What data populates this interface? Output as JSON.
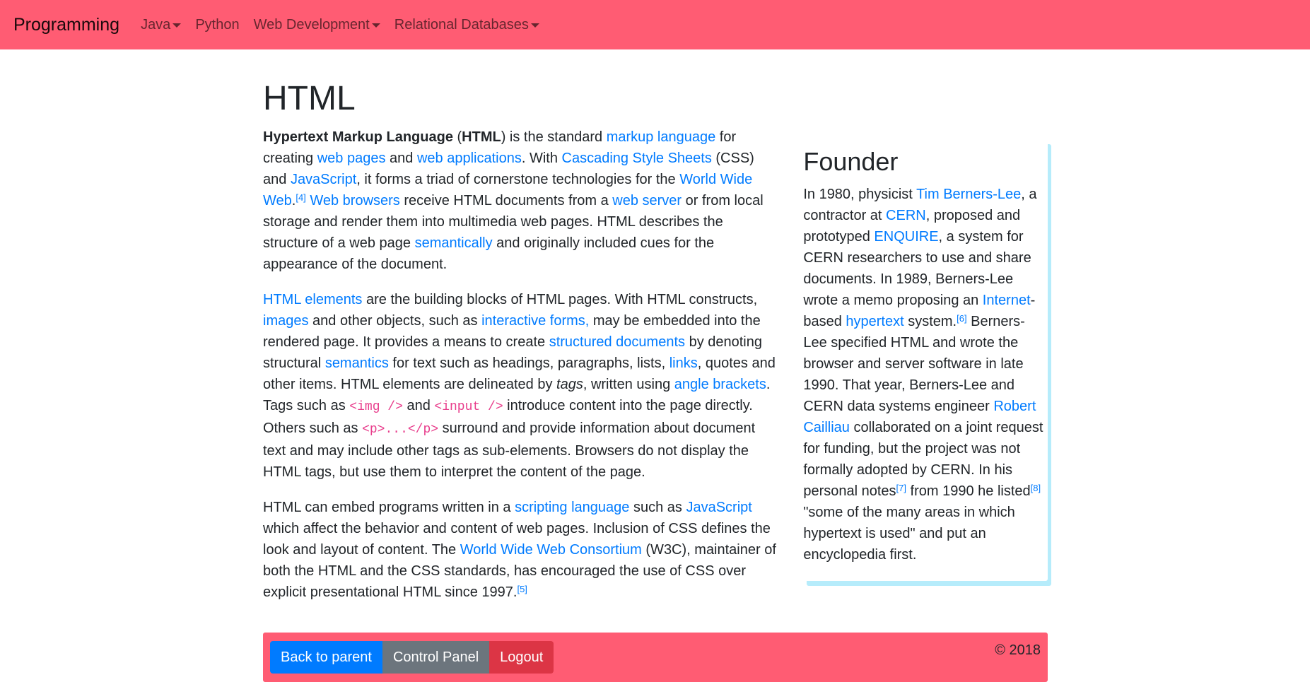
{
  "nav": {
    "brand": "Programming",
    "items": [
      {
        "label": "Java",
        "dropdown": true
      },
      {
        "label": "Python",
        "dropdown": false
      },
      {
        "label": "Web Development",
        "dropdown": true
      },
      {
        "label": "Relational Databases",
        "dropdown": true
      }
    ]
  },
  "page": {
    "title": "HTML"
  },
  "article": {
    "p1": {
      "t1": "Hypertext Markup Language",
      "t2": " (",
      "t3": "HTML",
      "t4": ") is the standard ",
      "l_markup": "markup language",
      "t5": " for creating ",
      "l_webpages": "web pages",
      "t6": " and ",
      "l_webapps": "web applications",
      "t7": ". With ",
      "l_css": "Cascading Style Sheets",
      "t8": " (CSS) and ",
      "l_js": "JavaScript",
      "t9": ", it forms a triad of cornerstone technologies for the ",
      "l_www": "World Wide Web",
      "t10": ".",
      "ref4": "[4]",
      "t11": " ",
      "l_browsers": "Web browsers",
      "t12": " receive HTML documents from a ",
      "l_server": "web server",
      "t13": " or from local storage and render them into multimedia web pages. HTML describes the structure of a web page ",
      "l_semantically": "semantically",
      "t14": " and originally included cues for the appearance of the document."
    },
    "p2": {
      "l_elements": "HTML elements",
      "t1": " are the building blocks of HTML pages. With HTML constructs, ",
      "l_images": "images",
      "t2": " and other objects, such as ",
      "l_forms": "interactive forms,",
      "t3": " may be embedded into the rendered page. It provides a means to create ",
      "l_structured": "structured documents",
      "t4": " by denoting structural ",
      "l_semantics": "semantics",
      "t5": " for text such as headings, paragraphs, lists, ",
      "l_links": "links",
      "t6": ", quotes and other items. HTML elements are delineated by ",
      "em_tags": "tags",
      "t7": ", written using ",
      "l_angle": "angle brackets",
      "t8": ". Tags such as ",
      "c_img": "<img />",
      "t9": " and ",
      "c_input": "<input />",
      "t10": " introduce content into the page directly. Others such as ",
      "c_p": "<p>...</p>",
      "t11": " surround and provide information about document text and may include other tags as sub-elements. Browsers do not display the HTML tags, but use them to interpret the content of the page."
    },
    "p3": {
      "t1": "HTML can embed programs written in a ",
      "l_scripting": "scripting language",
      "t2": " such as ",
      "l_js": "JavaScript",
      "t3": " which affect the behavior and content of web pages. Inclusion of CSS defines the look and layout of content. The ",
      "l_w3c": "World Wide Web Consortium",
      "t4": " (W3C), maintainer of both the HTML and the CSS standards, has encouraged the use of CSS over explicit presentational HTML since 1997.",
      "ref5": "[5]"
    }
  },
  "aside": {
    "title": "Founder",
    "t1": "In 1980, physicist ",
    "l_tbl": "Tim Berners-Lee",
    "t2": ", a contractor at ",
    "l_cern": "CERN",
    "t3": ", proposed and prototyped ",
    "l_enquire": "ENQUIRE",
    "t4": ", a system for CERN researchers to use and share documents. In 1989, Berners-Lee wrote a memo proposing an ",
    "l_internet": "Internet",
    "t5": "-based ",
    "l_hypertext": "hypertext",
    "t6": " system.",
    "ref6": "[6]",
    "t7": " Berners-Lee specified HTML and wrote the browser and server software in late 1990. That year, Berners-Lee and CERN data systems engineer ",
    "l_cailliau": "Robert Cailliau",
    "t8": " collaborated on a joint request for funding, but the project was not formally adopted by CERN. In his personal notes",
    "ref7": "[7]",
    "t9": " from 1990 he listed",
    "ref8": "[8]",
    "t10": " \"some of the many areas in which hypertext is used\" and put an encyclopedia first."
  },
  "footer": {
    "back_label": "Back to parent",
    "control_label": "Control Panel",
    "logout_label": "Logout",
    "copyright": "© 2018"
  },
  "colors": {
    "navbar": "#ff5c73",
    "link": "#007bff",
    "code": "#e83e8c",
    "aside_shadow": "#b6ecfb"
  }
}
